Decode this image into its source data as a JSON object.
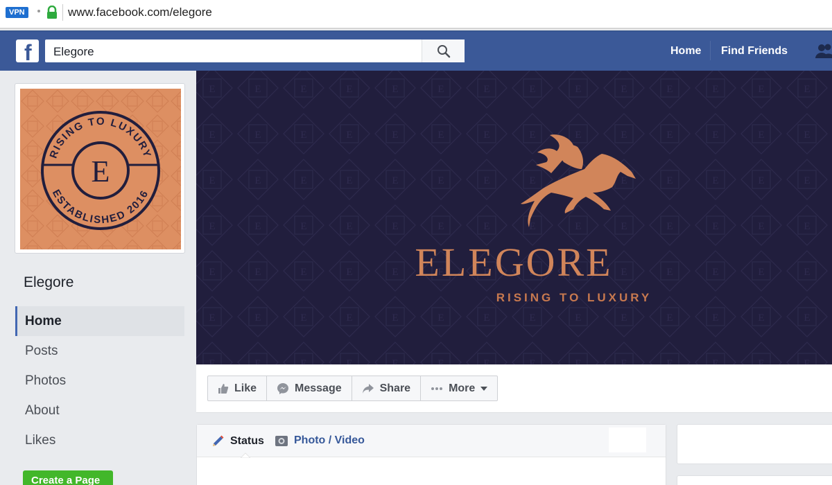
{
  "browser": {
    "vpn_label": "VPN",
    "url": "www.facebook.com/elegore"
  },
  "topbar": {
    "search_value": "Elegore",
    "nav_home": "Home",
    "nav_find_friends": "Find Friends",
    "brand_color": "#3b5998"
  },
  "profile": {
    "badge_top_text": "RISING TO LUXURY",
    "badge_bottom_text": "ESTABLISHED 2016",
    "badge_letter": "E"
  },
  "sidebar": {
    "page_name": "Elegore",
    "items": [
      {
        "label": "Home",
        "active": true
      },
      {
        "label": "Posts"
      },
      {
        "label": "Photos"
      },
      {
        "label": "About"
      },
      {
        "label": "Likes"
      }
    ],
    "create_page_label": "Create a Page"
  },
  "cover": {
    "brand_name": "ELEGORE",
    "tagline": "RISING TO LUXURY",
    "bg_color": "#211e3d",
    "accent_color": "#d1855a"
  },
  "actions": {
    "like": "Like",
    "message": "Message",
    "share": "Share",
    "more": "More"
  },
  "composer": {
    "status_tab": "Status",
    "photo_tab": "Photo / Video"
  }
}
